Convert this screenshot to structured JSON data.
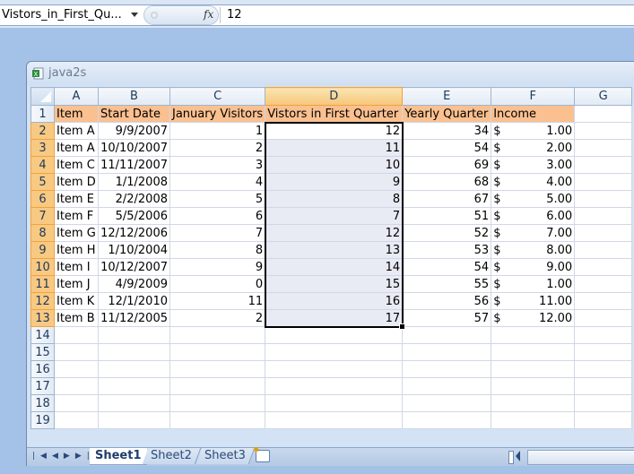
{
  "formula_bar": {
    "name_box": "Vistors_in_First_Qu...",
    "fx_label": "fx",
    "value": "12"
  },
  "window": {
    "title": "java2s",
    "icon": "excel-workbook-icon"
  },
  "sheet": {
    "columns": [
      "A",
      "B",
      "C",
      "D",
      "E",
      "F",
      "G"
    ],
    "selected_column": "D",
    "selected_range": "D2:D13",
    "active_cell": "D2",
    "header_row": [
      "Item",
      "Start Date",
      "January Visitors",
      "Vistors in First Quarter",
      "Yearly Quarter",
      "Income",
      ""
    ],
    "rows": [
      {
        "num": "2",
        "item": "Item A",
        "start": "9/9/2007",
        "jan": "1",
        "q1": "12",
        "yearly": "34",
        "cur": "$",
        "income": "1.00"
      },
      {
        "num": "3",
        "item": "Item A",
        "start": "10/10/2007",
        "jan": "2",
        "q1": "11",
        "yearly": "54",
        "cur": "$",
        "income": "2.00"
      },
      {
        "num": "4",
        "item": "Item C",
        "start": "11/11/2007",
        "jan": "3",
        "q1": "10",
        "yearly": "69",
        "cur": "$",
        "income": "3.00"
      },
      {
        "num": "5",
        "item": "Item D",
        "start": "1/1/2008",
        "jan": "4",
        "q1": "9",
        "yearly": "68",
        "cur": "$",
        "income": "4.00"
      },
      {
        "num": "6",
        "item": "Item E",
        "start": "2/2/2008",
        "jan": "5",
        "q1": "8",
        "yearly": "67",
        "cur": "$",
        "income": "5.00"
      },
      {
        "num": "7",
        "item": "Item F",
        "start": "5/5/2006",
        "jan": "6",
        "q1": "7",
        "yearly": "51",
        "cur": "$",
        "income": "6.00"
      },
      {
        "num": "8",
        "item": "Item G",
        "start": "12/12/2006",
        "jan": "7",
        "q1": "12",
        "yearly": "52",
        "cur": "$",
        "income": "7.00"
      },
      {
        "num": "9",
        "item": "Item H",
        "start": "1/10/2004",
        "jan": "8",
        "q1": "13",
        "yearly": "53",
        "cur": "$",
        "income": "8.00"
      },
      {
        "num": "10",
        "item": "Item I",
        "start": "10/12/2007",
        "jan": "9",
        "q1": "14",
        "yearly": "54",
        "cur": "$",
        "income": "9.00"
      },
      {
        "num": "11",
        "item": "Item J",
        "start": "4/9/2009",
        "jan": "0",
        "q1": "15",
        "yearly": "55",
        "cur": "$",
        "income": "1.00"
      },
      {
        "num": "12",
        "item": "Item K",
        "start": "12/1/2010",
        "jan": "11",
        "q1": "16",
        "yearly": "56",
        "cur": "$",
        "income": "11.00"
      },
      {
        "num": "13",
        "item": "Item B",
        "start": "11/12/2005",
        "jan": "2",
        "q1": "17",
        "yearly": "57",
        "cur": "$",
        "income": "12.00"
      }
    ],
    "empty_rows": [
      "14",
      "15",
      "16",
      "17",
      "18",
      "19"
    ]
  },
  "tabs": {
    "nav_glyphs": "◀◀ ◀ ▶ ▶▶",
    "sheets": [
      "Sheet1",
      "Sheet2",
      "Sheet3"
    ],
    "active": "Sheet1"
  },
  "colors": {
    "header_fill": "#fac090",
    "selection_fill": "#e8eaf4",
    "selected_header": "#f6c67a"
  }
}
